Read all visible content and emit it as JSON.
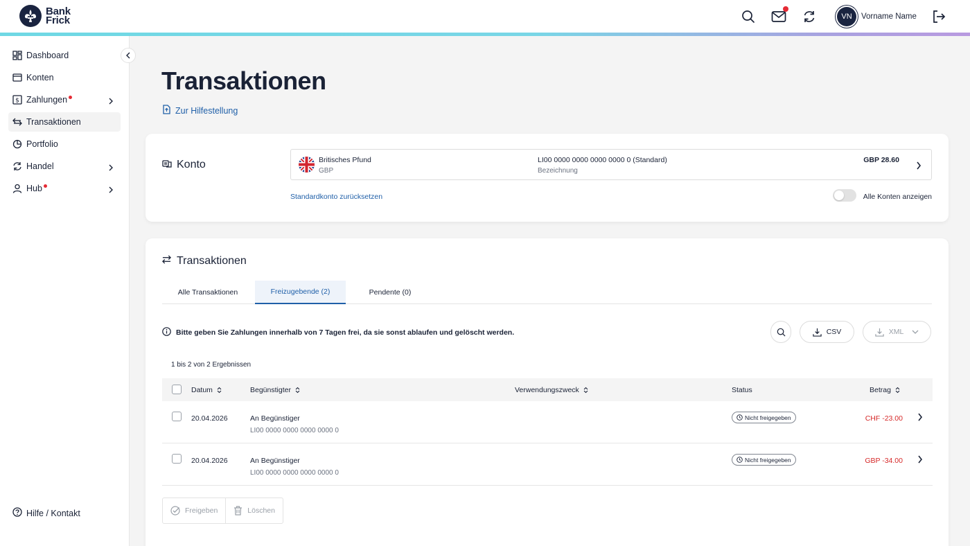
{
  "header": {
    "logo_line1": "Bank",
    "logo_line2": "Frick",
    "user_initials": "VN",
    "user_name": "Vorname Name"
  },
  "colors": {
    "primary_navy": "#1a2440",
    "link_blue": "#1f5fa8",
    "alert_red": "#e52b35",
    "amount_red": "#d62828"
  },
  "sidebar": {
    "items": [
      {
        "label": "Dashboard",
        "icon": "dashboard-icon"
      },
      {
        "label": "Konten",
        "icon": "wallet-icon"
      },
      {
        "label": "Zahlungen",
        "icon": "dollar-icon"
      },
      {
        "label": "Transaktionen",
        "icon": "arrows-icon"
      },
      {
        "label": "Portfolio",
        "icon": "pie-chart-icon"
      },
      {
        "label": "Handel",
        "icon": "refresh-icon"
      },
      {
        "label": "Hub",
        "icon": "user-icon"
      }
    ],
    "help": "Hilfe / Kontakt"
  },
  "page": {
    "title": "Transaktionen",
    "help_link": "Zur Hilfestellung"
  },
  "konto": {
    "title": "Konto",
    "account_name": "Britisches Pfund",
    "currency": "GBP",
    "iban": "LI00 0000 0000 0000 0000 0 (Standard)",
    "description": "Bezeichnung",
    "balance": "GBP 28.60",
    "reset_link": "Standardkonto zurücksetzen",
    "toggle_label": "Alle Konten anzeigen"
  },
  "transactions": {
    "title": "Transaktionen",
    "tabs": [
      "Alle Transaktionen",
      "Freizugebende (2)",
      "Pendente (0)"
    ],
    "info": "Bitte geben Sie Zahlungen innerhalb von 7 Tagen frei, da sie sonst ablaufen und gelöscht werden.",
    "csv": "CSV",
    "xml": "XML",
    "results": "1 bis 2 von 2 Ergebnissen",
    "columns": {
      "date": "Datum",
      "beneficiary": "Begünstigter",
      "purpose": "Verwendungszweck",
      "status": "Status",
      "amount": "Betrag"
    },
    "rows": [
      {
        "date": "20.04.2026",
        "beneficiary": "An Begünstiger",
        "iban": "LI00 0000 0000 0000 0000 0",
        "status": "Nicht freigegeben",
        "amount": "CHF -23.00"
      },
      {
        "date": "20.04.2026",
        "beneficiary": "An Begünstiger",
        "iban": "LI00 0000 0000 0000 0000 0",
        "status": "Nicht freigegeben",
        "amount": "GBP -34.00"
      }
    ],
    "approve": "Freigeben",
    "delete": "Löschen"
  }
}
